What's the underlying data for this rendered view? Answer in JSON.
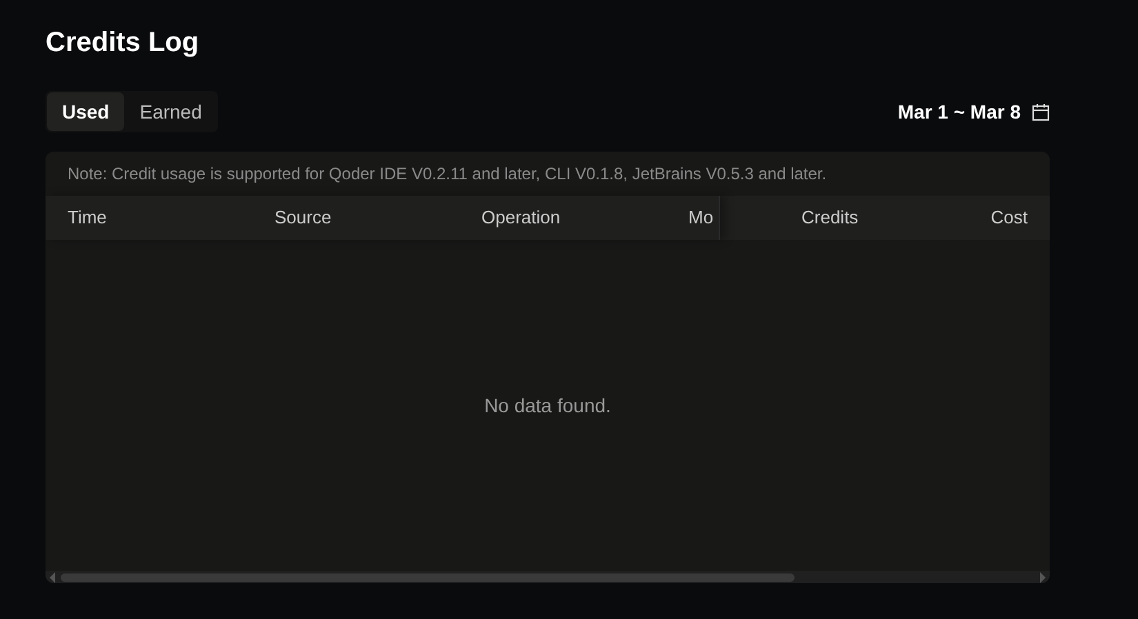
{
  "title": "Credits Log",
  "tabs": [
    {
      "label": "Used",
      "selected": true
    },
    {
      "label": "Earned",
      "selected": false
    }
  ],
  "date_range": "Mar 1 ~ Mar 8",
  "table": {
    "note": "Note: Credit usage is supported for Qoder IDE V0.2.11 and later, CLI V0.1.8, JetBrains V0.5.3 and later.",
    "columns": [
      "Time",
      "Source",
      "Operation",
      "Mo"
    ],
    "fixed_columns": [
      "Credits",
      "Cost"
    ],
    "empty_text": "No data found."
  }
}
